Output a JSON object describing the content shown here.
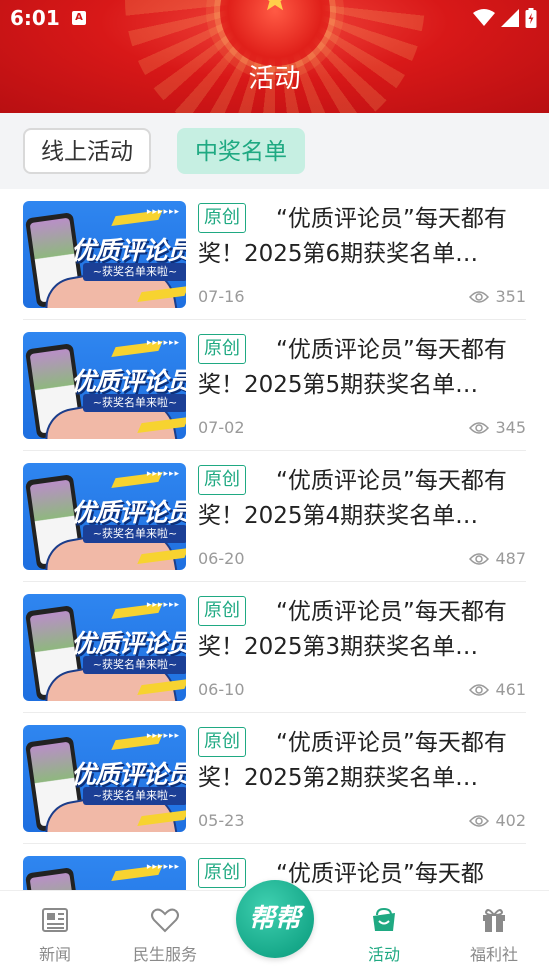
{
  "status_bar": {
    "time": "6:01",
    "notification_letter": "A"
  },
  "header": {
    "title": "活动"
  },
  "tabs": [
    {
      "label": "线上活动",
      "selected": false
    },
    {
      "label": "中奖名单",
      "selected": true
    }
  ],
  "thumbnail": {
    "headline": "优质评论员",
    "subline": "~获奖名单来啦~"
  },
  "badge_label": "原创",
  "articles": [
    {
      "title": "“优质评论员”每天都有奖！2025第6期获奖名单…",
      "date": "07-16",
      "views": "351"
    },
    {
      "title": "“优质评论员”每天都有奖！2025第5期获奖名单…",
      "date": "07-02",
      "views": "345"
    },
    {
      "title": "“优质评论员”每天都有奖！2025第4期获奖名单…",
      "date": "06-20",
      "views": "487"
    },
    {
      "title": "“优质评论员”每天都有奖！2025第3期获奖名单…",
      "date": "06-10",
      "views": "461"
    },
    {
      "title": "“优质评论员”每天都有奖！2025第2期获奖名单…",
      "date": "05-23",
      "views": "402"
    },
    {
      "title": "“优质评论员”每天都",
      "date": "",
      "views": ""
    }
  ],
  "bottom_nav": {
    "items": [
      {
        "label": "新闻",
        "icon": "newspaper-icon"
      },
      {
        "label": "民生服务",
        "icon": "heart-icon"
      },
      {
        "label": "活动",
        "icon": "bag-icon",
        "active": true
      },
      {
        "label": "福利社",
        "icon": "gift-icon"
      }
    ],
    "center_button": "帮帮"
  },
  "colors": {
    "header_red": "#d81818",
    "accent_green": "#1fa982",
    "tab_selected_bg": "#c6efe2"
  }
}
